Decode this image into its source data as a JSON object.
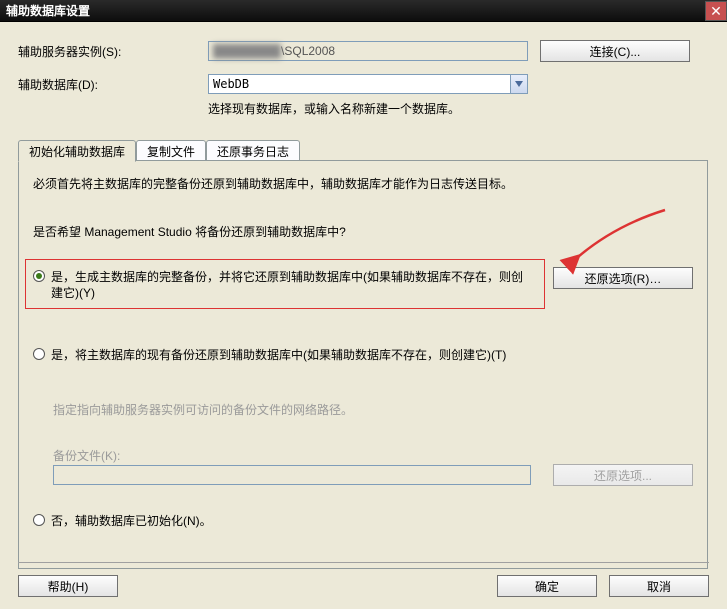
{
  "window": {
    "title": "辅助数据库设置",
    "close": "✕"
  },
  "form": {
    "server_instance_label": "辅助服务器实例(S):",
    "server_instance_value": "\\SQL2008",
    "connect_button": "连接(C)...",
    "secondary_db_label": "辅助数据库(D):",
    "secondary_db_value": "WebDB",
    "secondary_db_hint": "选择现有数据库，或输入名称新建一个数据库。"
  },
  "tabs": {
    "init": "初始化辅助数据库",
    "copy": "复制文件",
    "restore": "还原事务日志"
  },
  "init_tab": {
    "header_text": "必须首先将主数据库的完整备份还原到辅助数据库中，辅助数据库才能作为日志传送目标。",
    "question_text": "是否希望 Management Studio 将备份还原到辅助数据库中?",
    "opt1": "是，生成主数据库的完整备份，并将它还原到辅助数据库中(如果辅助数据库不存在，则创建它)(Y)",
    "restore_options_btn": "还原选项(R)…",
    "opt2": "是，将主数据库的现有备份还原到辅助数据库中(如果辅助数据库不存在，则创建它)(T)",
    "path_hint": "指定指向辅助服务器实例可访问的备份文件的网络路径。",
    "backup_file_label": "备份文件(K):",
    "restore_options_btn2": "还原选项...",
    "opt3": "否，辅助数据库已初始化(N)。"
  },
  "buttons": {
    "help": "帮助(H)",
    "ok": "确定",
    "cancel": "取消"
  }
}
